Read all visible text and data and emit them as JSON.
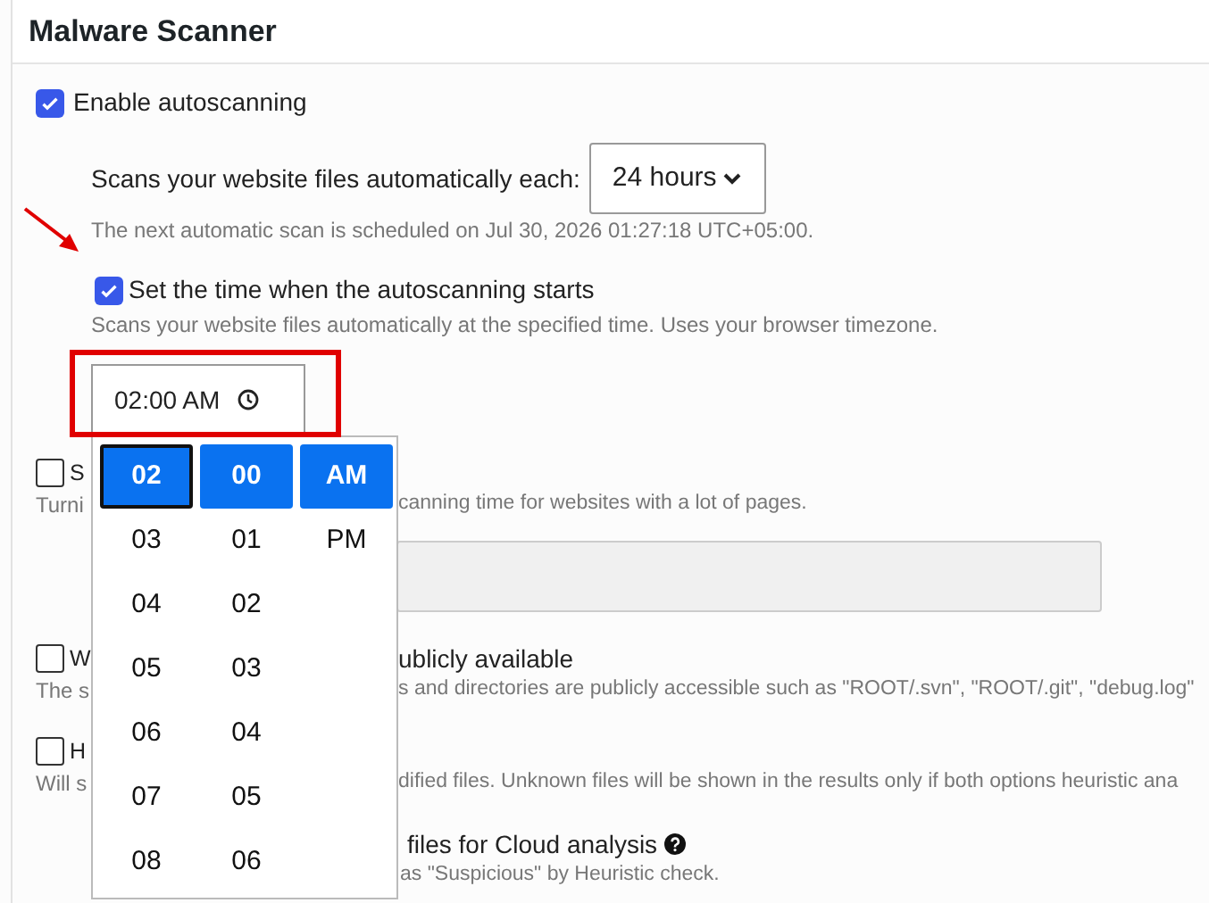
{
  "title": "Malware Scanner",
  "autoscan": {
    "label": "Enable autoscanning",
    "checked": true
  },
  "interval": {
    "label": "Scans your website files automatically each:",
    "value": "24 hours"
  },
  "next_scan": "The next automatic scan is scheduled on Jul 30, 2026 01:27:18 UTC+05:00.",
  "set_time": {
    "label": "Set the time when the autoscanning starts",
    "checked": true,
    "description": "Scans your website files automatically at the specified time. Uses your browser timezone."
  },
  "time_field": {
    "value": "02:00 AM"
  },
  "time_picker": {
    "columns": [
      {
        "items": [
          {
            "label": "02",
            "selected": true,
            "focused": true
          },
          {
            "label": "03",
            "selected": false,
            "focused": false
          },
          {
            "label": "04",
            "selected": false,
            "focused": false
          },
          {
            "label": "05",
            "selected": false,
            "focused": false
          },
          {
            "label": "06",
            "selected": false,
            "focused": false
          },
          {
            "label": "07",
            "selected": false,
            "focused": false
          },
          {
            "label": "08",
            "selected": false,
            "focused": false
          }
        ]
      },
      {
        "items": [
          {
            "label": "00",
            "selected": true,
            "focused": false
          },
          {
            "label": "01",
            "selected": false,
            "focused": false
          },
          {
            "label": "02",
            "selected": false,
            "focused": false
          },
          {
            "label": "03",
            "selected": false,
            "focused": false
          },
          {
            "label": "04",
            "selected": false,
            "focused": false
          },
          {
            "label": "05",
            "selected": false,
            "focused": false
          },
          {
            "label": "06",
            "selected": false,
            "focused": false
          }
        ]
      },
      {
        "items": [
          {
            "label": "AM",
            "selected": true,
            "focused": false
          },
          {
            "label": "PM",
            "selected": false,
            "focused": false
          }
        ]
      }
    ]
  },
  "options": [
    {
      "kind": "checkbox",
      "checked": false,
      "label_start": "S",
      "desc_start": "Turni",
      "desc_end": "canning time for websites with a lot of pages."
    },
    {
      "kind": "field"
    },
    {
      "kind": "checkbox",
      "checked": false,
      "label_start": "W",
      "label_end": "ublicly available",
      "desc_start": "The s",
      "desc_end": "s and directories are publicly accessible such as \"ROOT/.svn\", \"ROOT/.git\", \"debug.log\""
    },
    {
      "kind": "checkbox",
      "checked": false,
      "label_start": "H",
      "desc_start": "Will s",
      "desc_end": "dified files. Unknown files will be shown in the results only if both options heuristic ana"
    },
    {
      "kind": "note",
      "label_end": "files for Cloud analysis",
      "help": true,
      "desc_end": "as \"Suspicious\" by Heuristic check."
    }
  ]
}
